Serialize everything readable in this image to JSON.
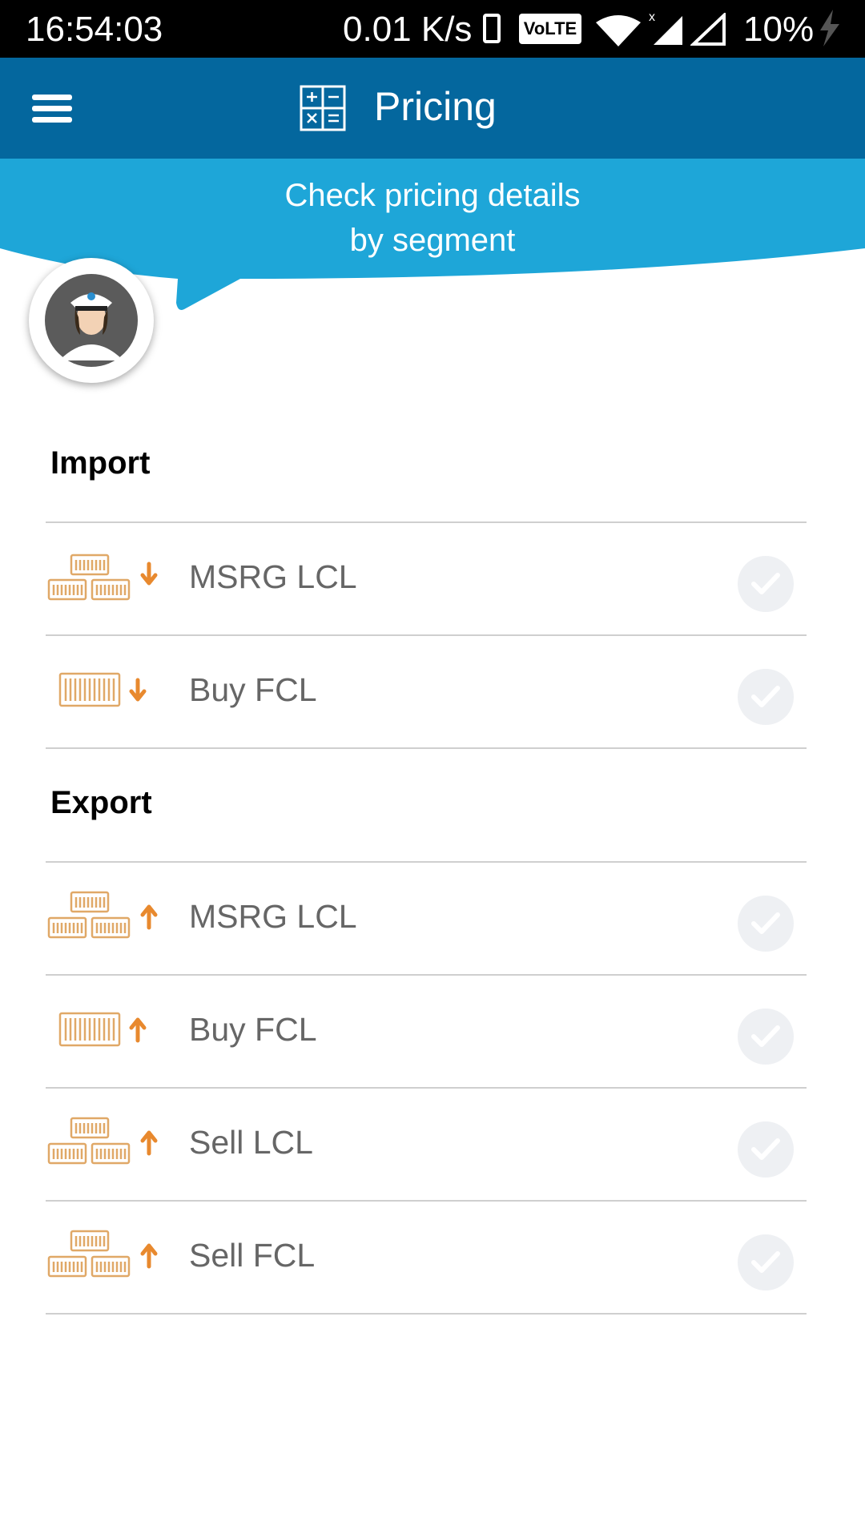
{
  "status_bar": {
    "time": "16:54:03",
    "net_speed": "0.01 K/s",
    "volte": "VoLTE",
    "battery": "10%"
  },
  "app_bar": {
    "title": "Pricing",
    "menu_icon": "hamburger-menu-icon",
    "title_icon": "calculator-icon"
  },
  "banner": {
    "line1": "Check pricing details",
    "line2": "by segment",
    "color": "#1ea6d8"
  },
  "sections": {
    "import": {
      "heading": "Import",
      "items": [
        {
          "label": "MSRG LCL",
          "icon": "lcl-import-icon"
        },
        {
          "label": "Buy FCL",
          "icon": "fcl-import-icon"
        }
      ]
    },
    "export": {
      "heading": "Export",
      "items": [
        {
          "label": "MSRG LCL",
          "icon": "lcl-export-icon"
        },
        {
          "label": "Buy FCL",
          "icon": "fcl-export-icon"
        },
        {
          "label": "Sell LCL",
          "icon": "lcl-export-icon"
        },
        {
          "label": "Sell FCL",
          "icon": "lcl-export-icon"
        }
      ]
    }
  },
  "colors": {
    "status_bar": "#000000",
    "app_bar": "#04679e",
    "banner": "#1ea6d8",
    "accent_orange": "#e8892e",
    "check_bg": "#eef0f3"
  }
}
